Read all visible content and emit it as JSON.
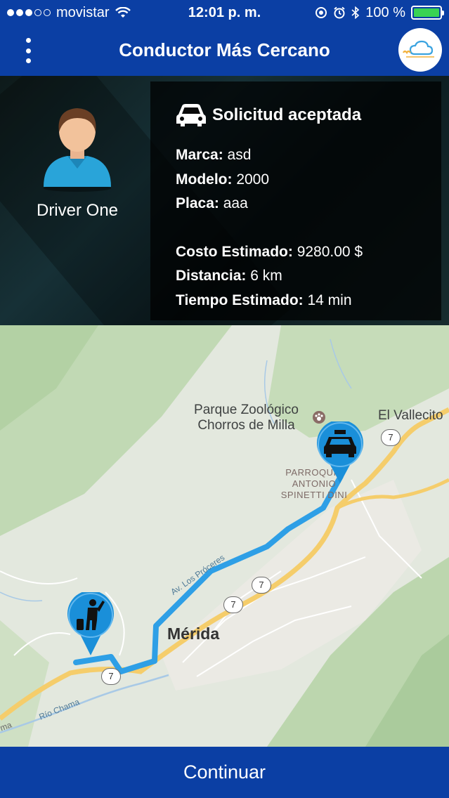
{
  "status_bar": {
    "carrier": "movistar",
    "time": "12:01 p. m.",
    "battery": "100 %",
    "battery_level": 1.0
  },
  "navbar": {
    "title": "Conductor Más Cercano",
    "menu_icon": "more-vertical-icon",
    "logo_icon": "company-logo"
  },
  "driver": {
    "name": "Driver One"
  },
  "trip": {
    "header": "Solicitud aceptada",
    "brand_label": "Marca:",
    "brand_value": "asd",
    "model_label": "Modelo:",
    "model_value": "2000",
    "plate_label": "Placa:",
    "plate_value": "aaa",
    "cost_label": "Costo Estimado:",
    "cost_value": "9280.00 $",
    "distance_label": "Distancia:",
    "distance_value": "6 km",
    "time_label": "Tiempo Estimado:",
    "time_value": "14 min"
  },
  "map": {
    "zoo_line1": "Parque Zoológico",
    "zoo_line2": "Chorros de Milla",
    "town": "El Vallecito",
    "parish_line1": "PARROQUIA",
    "parish_line2": "ANTONIO",
    "parish_line3": "SPINETTI DINI",
    "city": "Mérida",
    "street": "Av. Los Próceres",
    "river": "Río Chama",
    "river_cut": "ma",
    "route_badge": "7",
    "colors": {
      "route": "#2e9fe6",
      "pin": "#1a8fd9",
      "highway": "#f5cd6b",
      "forest": "#c4dcb6"
    }
  },
  "footer": {
    "button_label": "Continuar"
  },
  "colors": {
    "primary": "#0b3fa4",
    "battery": "#39d353"
  }
}
